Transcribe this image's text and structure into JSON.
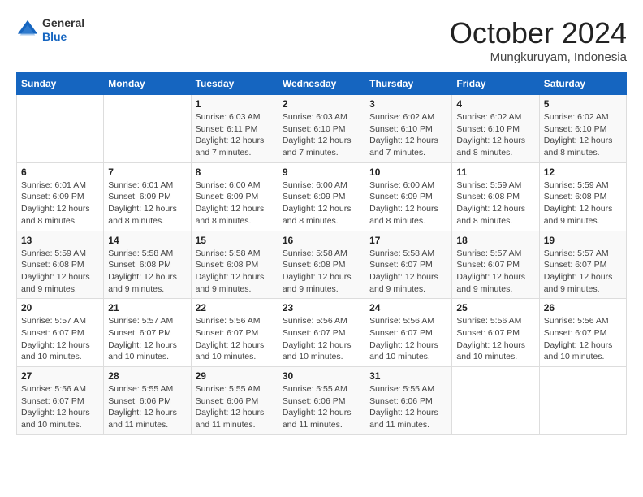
{
  "header": {
    "logo": {
      "line1": "General",
      "line2": "Blue"
    },
    "month": "October 2024",
    "location": "Mungkuruyam, Indonesia"
  },
  "weekdays": [
    "Sunday",
    "Monday",
    "Tuesday",
    "Wednesday",
    "Thursday",
    "Friday",
    "Saturday"
  ],
  "weeks": [
    [
      {
        "day": "",
        "info": ""
      },
      {
        "day": "",
        "info": ""
      },
      {
        "day": "1",
        "info": "Sunrise: 6:03 AM\nSunset: 6:11 PM\nDaylight: 12 hours and 7 minutes."
      },
      {
        "day": "2",
        "info": "Sunrise: 6:03 AM\nSunset: 6:10 PM\nDaylight: 12 hours and 7 minutes."
      },
      {
        "day": "3",
        "info": "Sunrise: 6:02 AM\nSunset: 6:10 PM\nDaylight: 12 hours and 7 minutes."
      },
      {
        "day": "4",
        "info": "Sunrise: 6:02 AM\nSunset: 6:10 PM\nDaylight: 12 hours and 8 minutes."
      },
      {
        "day": "5",
        "info": "Sunrise: 6:02 AM\nSunset: 6:10 PM\nDaylight: 12 hours and 8 minutes."
      }
    ],
    [
      {
        "day": "6",
        "info": "Sunrise: 6:01 AM\nSunset: 6:09 PM\nDaylight: 12 hours and 8 minutes."
      },
      {
        "day": "7",
        "info": "Sunrise: 6:01 AM\nSunset: 6:09 PM\nDaylight: 12 hours and 8 minutes."
      },
      {
        "day": "8",
        "info": "Sunrise: 6:00 AM\nSunset: 6:09 PM\nDaylight: 12 hours and 8 minutes."
      },
      {
        "day": "9",
        "info": "Sunrise: 6:00 AM\nSunset: 6:09 PM\nDaylight: 12 hours and 8 minutes."
      },
      {
        "day": "10",
        "info": "Sunrise: 6:00 AM\nSunset: 6:09 PM\nDaylight: 12 hours and 8 minutes."
      },
      {
        "day": "11",
        "info": "Sunrise: 5:59 AM\nSunset: 6:08 PM\nDaylight: 12 hours and 8 minutes."
      },
      {
        "day": "12",
        "info": "Sunrise: 5:59 AM\nSunset: 6:08 PM\nDaylight: 12 hours and 9 minutes."
      }
    ],
    [
      {
        "day": "13",
        "info": "Sunrise: 5:59 AM\nSunset: 6:08 PM\nDaylight: 12 hours and 9 minutes."
      },
      {
        "day": "14",
        "info": "Sunrise: 5:58 AM\nSunset: 6:08 PM\nDaylight: 12 hours and 9 minutes."
      },
      {
        "day": "15",
        "info": "Sunrise: 5:58 AM\nSunset: 6:08 PM\nDaylight: 12 hours and 9 minutes."
      },
      {
        "day": "16",
        "info": "Sunrise: 5:58 AM\nSunset: 6:08 PM\nDaylight: 12 hours and 9 minutes."
      },
      {
        "day": "17",
        "info": "Sunrise: 5:58 AM\nSunset: 6:07 PM\nDaylight: 12 hours and 9 minutes."
      },
      {
        "day": "18",
        "info": "Sunrise: 5:57 AM\nSunset: 6:07 PM\nDaylight: 12 hours and 9 minutes."
      },
      {
        "day": "19",
        "info": "Sunrise: 5:57 AM\nSunset: 6:07 PM\nDaylight: 12 hours and 9 minutes."
      }
    ],
    [
      {
        "day": "20",
        "info": "Sunrise: 5:57 AM\nSunset: 6:07 PM\nDaylight: 12 hours and 10 minutes."
      },
      {
        "day": "21",
        "info": "Sunrise: 5:57 AM\nSunset: 6:07 PM\nDaylight: 12 hours and 10 minutes."
      },
      {
        "day": "22",
        "info": "Sunrise: 5:56 AM\nSunset: 6:07 PM\nDaylight: 12 hours and 10 minutes."
      },
      {
        "day": "23",
        "info": "Sunrise: 5:56 AM\nSunset: 6:07 PM\nDaylight: 12 hours and 10 minutes."
      },
      {
        "day": "24",
        "info": "Sunrise: 5:56 AM\nSunset: 6:07 PM\nDaylight: 12 hours and 10 minutes."
      },
      {
        "day": "25",
        "info": "Sunrise: 5:56 AM\nSunset: 6:07 PM\nDaylight: 12 hours and 10 minutes."
      },
      {
        "day": "26",
        "info": "Sunrise: 5:56 AM\nSunset: 6:07 PM\nDaylight: 12 hours and 10 minutes."
      }
    ],
    [
      {
        "day": "27",
        "info": "Sunrise: 5:56 AM\nSunset: 6:07 PM\nDaylight: 12 hours and 10 minutes."
      },
      {
        "day": "28",
        "info": "Sunrise: 5:55 AM\nSunset: 6:06 PM\nDaylight: 12 hours and 11 minutes."
      },
      {
        "day": "29",
        "info": "Sunrise: 5:55 AM\nSunset: 6:06 PM\nDaylight: 12 hours and 11 minutes."
      },
      {
        "day": "30",
        "info": "Sunrise: 5:55 AM\nSunset: 6:06 PM\nDaylight: 12 hours and 11 minutes."
      },
      {
        "day": "31",
        "info": "Sunrise: 5:55 AM\nSunset: 6:06 PM\nDaylight: 12 hours and 11 minutes."
      },
      {
        "day": "",
        "info": ""
      },
      {
        "day": "",
        "info": ""
      }
    ]
  ],
  "colors": {
    "header_bg": "#1565c0",
    "logo_blue": "#1565c0"
  }
}
